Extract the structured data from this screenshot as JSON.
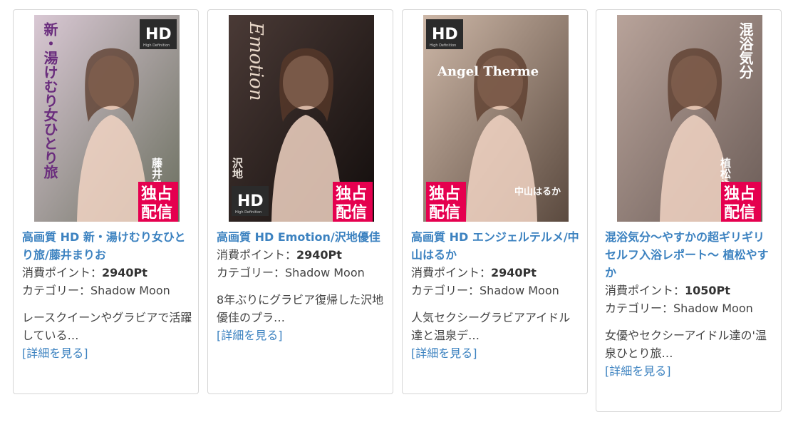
{
  "labels": {
    "points": "消費ポイント：",
    "category": "カテゴリー：",
    "detail": "[詳細を見る]"
  },
  "thumbnail_text": {
    "hd": "HD",
    "hd_sub": "High Definition",
    "exclusive_1": "独占",
    "exclusive_2": "配信"
  },
  "products": [
    {
      "title": "高画質 HD 新・湯けむり女ひとり旅/藤井まりお",
      "points": "2940Pt",
      "category": "Shadow Moon",
      "desc": "レースクイーンやグラビアで活躍している…",
      "cover_text": "新・湯けむり女ひとり旅",
      "cover_name": "藤井まりお",
      "colors": {
        "bg1": "#d9c8d4",
        "bg2": "#6b6f5f",
        "accent": "#7a3d8c"
      }
    },
    {
      "title": "高画質 HD Emotion/沢地優佳",
      "points": "2940Pt",
      "category": "Shadow Moon",
      "desc": "8年ぶりにグラビア復帰した沢地優佳のプラ…",
      "cover_text": "Emotion",
      "cover_name": "沢地",
      "colors": {
        "bg1": "#4a3a36",
        "bg2": "#120d0c",
        "accent": "#e8d7c8"
      }
    },
    {
      "title": "高画質 HD エンジェルテルメ/中山はるか",
      "points": "2940Pt",
      "category": "Shadow Moon",
      "desc": "人気セクシーグラビアアイドル達と温泉デ…",
      "cover_text": "Angel Therme",
      "cover_name": "中山はるか",
      "colors": {
        "bg1": "#cdb7a7",
        "bg2": "#5b4a3f",
        "accent": "#f5f0f2"
      }
    },
    {
      "title": "混浴気分～やすかの超ギリギリセルフ入浴レポート～ 植松やすか",
      "points": "1050Pt",
      "category": "Shadow Moon",
      "desc": "女優やセクシーアイドル達の'温泉ひとり旅…",
      "cover_text": "混浴気分",
      "cover_name": "植松やすか",
      "colors": {
        "bg1": "#b8a39a",
        "bg2": "#6b5c57",
        "accent": "#e8418b"
      }
    }
  ]
}
